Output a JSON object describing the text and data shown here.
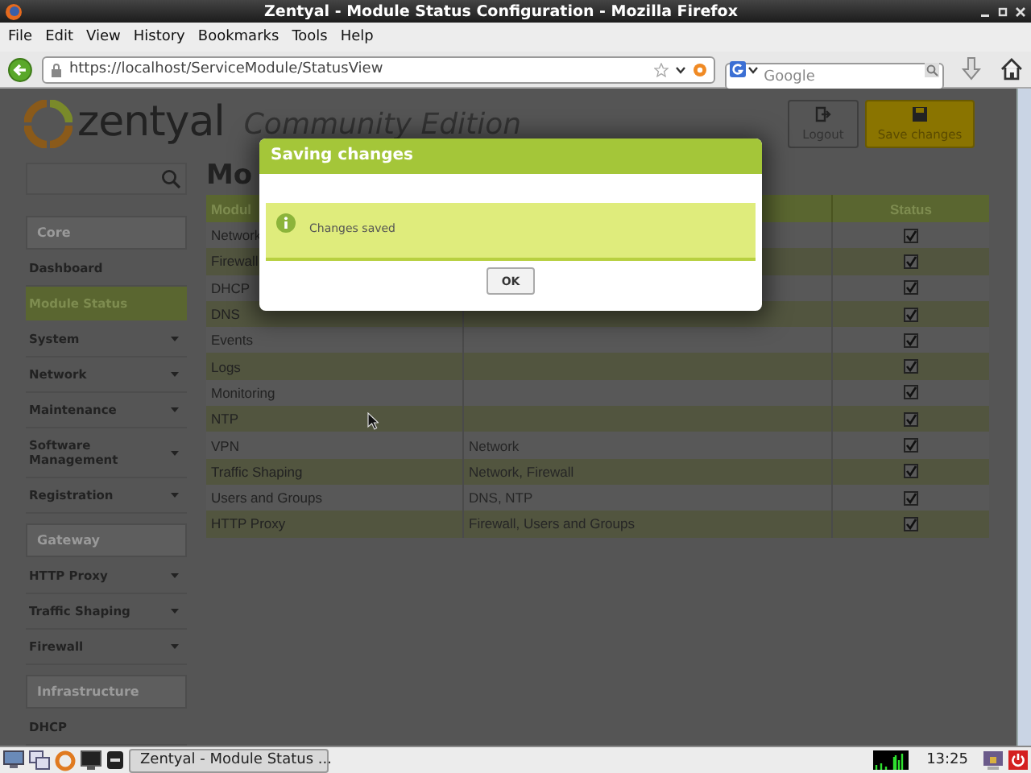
{
  "window": {
    "title": "Zentyal - Module Status Configuration - Mozilla Firefox"
  },
  "menu": [
    "File",
    "Edit",
    "View",
    "History",
    "Bookmarks",
    "Tools",
    "Help"
  ],
  "address_bar": {
    "url": "https://localhost/ServiceModule/StatusView"
  },
  "search_bar": {
    "placeholder": "Google"
  },
  "header": {
    "logo": "zentyal",
    "edition": "Community Edition",
    "buttons": [
      {
        "label": "Logout",
        "kind": "logout"
      },
      {
        "label": "Save changes",
        "kind": "save"
      }
    ]
  },
  "sidebar": {
    "sections": [
      {
        "title": "Core",
        "items": [
          {
            "label": "Dashboard",
            "selected": false,
            "submenu": false
          },
          {
            "label": "Module Status",
            "selected": true,
            "submenu": false
          },
          {
            "label": "System",
            "selected": false,
            "submenu": true
          },
          {
            "label": "Network",
            "selected": false,
            "submenu": true
          },
          {
            "label": "Maintenance",
            "selected": false,
            "submenu": true
          },
          {
            "label": "Software Management",
            "selected": false,
            "submenu": true
          },
          {
            "label": "Registration",
            "selected": false,
            "submenu": true
          }
        ]
      },
      {
        "title": "Gateway",
        "items": [
          {
            "label": "HTTP Proxy",
            "selected": false,
            "submenu": true
          },
          {
            "label": "Traffic Shaping",
            "selected": false,
            "submenu": true
          },
          {
            "label": "Firewall",
            "selected": false,
            "submenu": true
          }
        ]
      },
      {
        "title": "Infrastructure",
        "items": [
          {
            "label": "DHCP",
            "selected": false,
            "submenu": false
          }
        ]
      }
    ]
  },
  "page_title": "Mo",
  "table": {
    "columns": {
      "module": "Modul",
      "status": "Status"
    },
    "rows": [
      {
        "module": "Network",
        "enabled": true
      },
      {
        "module": "Firewall",
        "enabled": true
      },
      {
        "module": "DHCP",
        "enabled": true
      },
      {
        "module": "DNS",
        "enabled": true
      },
      {
        "module": "Events",
        "enabled": true
      },
      {
        "module": "Logs",
        "enabled": true
      },
      {
        "module": "Monitoring",
        "enabled": true
      },
      {
        "module": "NTP",
        "enabled": true
      },
      {
        "module": "VPN",
        "depends": "Network",
        "enabled": true
      },
      {
        "module": "Traffic Shaping",
        "depends": "Network, Firewall",
        "enabled": true
      },
      {
        "module": "Users and Groups",
        "depends": "DNS, NTP",
        "enabled": true
      },
      {
        "module": "HTTP Proxy",
        "depends": "Firewall, Users and Groups",
        "enabled": true
      }
    ]
  },
  "dialog": {
    "title": "Saving changes",
    "message": "Changes saved",
    "button": "OK"
  },
  "taskbar": {
    "task": "Zentyal - Module Status ...",
    "clock": "13:25"
  }
}
